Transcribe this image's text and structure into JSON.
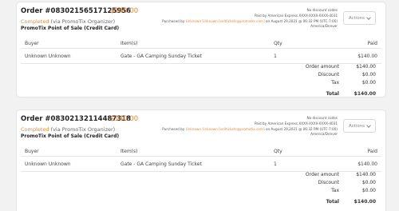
{
  "orders": [
    {
      "title": "Order #08302156517125956",
      "amount": "$140.00",
      "status": "Completed",
      "status_via": "(via PromoTix Organizer)",
      "pos": "PromoTix Point of Sale (Credit Card)",
      "meta": {
        "discount": "No discount codes",
        "paid_by": "Paid by American Express XXXX-XXXX-XXXX-4031",
        "purchased_prefix": "Purchased by",
        "purchaser": "Unknown Unknown",
        "email": "[selltickets@promotix.com]",
        "purchased_date": "on August 29,2021 @ 06:32 PM (UTC-7:00)",
        "timezone": "America/Denver"
      },
      "actions_label": "Actions",
      "table": {
        "headers": [
          "Buyer",
          "Item(s)",
          "Qty",
          "Paid"
        ],
        "rows": [
          [
            "Unknown Unknown",
            "Gate - GA Camping Sunday Ticket",
            "1",
            "$140.00"
          ]
        ]
      },
      "totals": [
        {
          "label": "Order amount",
          "value": "$140.00"
        },
        {
          "label": "Discount",
          "value": "$0.00"
        },
        {
          "label": "Tax",
          "value": "$0.00"
        },
        {
          "label": "Total",
          "value": "$140.00"
        }
      ]
    },
    {
      "title": "Order #08302132114487318",
      "amount": "$140.00",
      "status": "Completed",
      "status_via": "(via PromoTix Organizer)",
      "pos": "PromoTix Point of Sale (Credit Card)",
      "meta": {
        "discount": "No discount codes",
        "paid_by": "Paid by American Express XXXX-XXXX-XXXX-4031",
        "purchased_prefix": "Purchased by",
        "purchaser": "Unknown Unknown",
        "email": "[selltickets@promotix.com]",
        "purchased_date": "on August 29,2021 @ 06:32 PM (UTC-7:00)",
        "timezone": "America/Denver"
      },
      "actions_label": "Actions",
      "table": {
        "headers": [
          "Buyer",
          "Item(s)",
          "Qty",
          "Paid"
        ],
        "rows": [
          [
            "Unknown Unknown",
            "Gate - GA Camping Sunday Ticket",
            "1",
            "$140.00"
          ]
        ]
      },
      "totals": [
        {
          "label": "Order amount",
          "value": "$140.00"
        },
        {
          "label": "Discount",
          "value": "$0.00"
        },
        {
          "label": "Tax",
          "value": "$0.00"
        },
        {
          "label": "Total",
          "value": "$140.00"
        }
      ]
    }
  ],
  "colors": {
    "accent": "#e8893a",
    "background": "#f2f2f2",
    "card": "#ffffff"
  }
}
